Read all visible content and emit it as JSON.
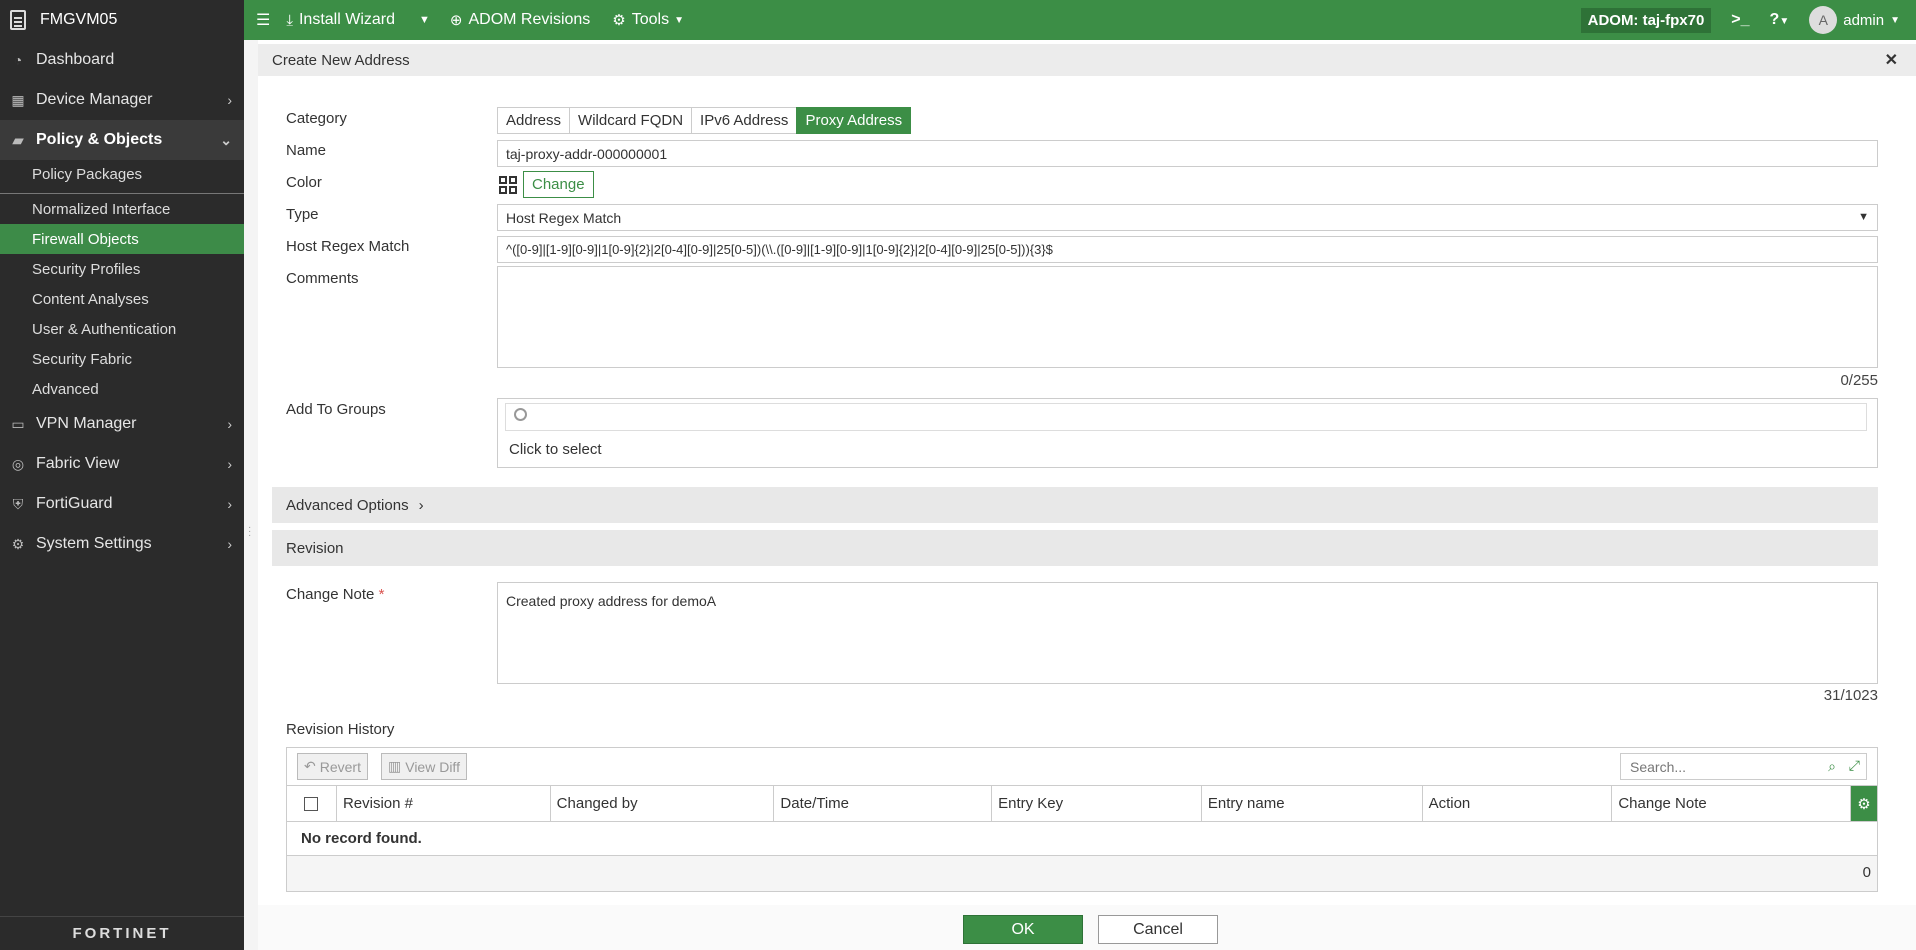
{
  "sidebar": {
    "device_name": "FMGVM05",
    "items": [
      {
        "label": "Dashboard",
        "icon": "dashboard-icon"
      },
      {
        "label": "Device Manager",
        "icon": "device-manager-icon"
      },
      {
        "label": "Policy & Objects",
        "icon": "policy-icon"
      },
      {
        "label": "VPN Manager",
        "icon": "vpn-icon"
      },
      {
        "label": "Fabric View",
        "icon": "fabric-icon"
      },
      {
        "label": "FortiGuard",
        "icon": "fortiguard-icon"
      },
      {
        "label": "System Settings",
        "icon": "settings-icon"
      }
    ],
    "subitems": [
      "Policy Packages",
      "Normalized Interface",
      "Firewall Objects",
      "Security Profiles",
      "Content Analyses",
      "User & Authentication",
      "Security Fabric",
      "Advanced"
    ],
    "active_subitem": "Firewall Objects",
    "footer": "FORTINET"
  },
  "topbar": {
    "install_wizard": "Install Wizard",
    "adom_revisions": "ADOM Revisions",
    "tools": "Tools",
    "adom": "ADOM: taj-fpx70",
    "user": "admin",
    "avatar_letter": "A"
  },
  "dialog": {
    "title": "Create New Address",
    "labels": {
      "category": "Category",
      "name": "Name",
      "color": "Color",
      "type": "Type",
      "host_regex": "Host Regex Match",
      "comments": "Comments",
      "add_to_groups": "Add To Groups",
      "change_note": "Change Note",
      "revision_history": "Revision History"
    },
    "categories": [
      "Address",
      "Wildcard FQDN",
      "IPv6 Address",
      "Proxy Address"
    ],
    "selected_category": "Proxy Address",
    "name_value": "taj-proxy-addr-000000001",
    "color_button": "Change",
    "type_value": "Host Regex Match",
    "host_regex_value": "^([0-9]|[1-9][0-9]|1[0-9]{2}|2[0-4][0-9]|25[0-5])(\\\\.([0-9]|[1-9][0-9]|1[0-9]{2}|2[0-4][0-9]|25[0-5])){3}$",
    "comments_counter": "0/255",
    "groups_placeholder": "Click to select",
    "advanced_options": "Advanced Options",
    "revision_section": "Revision",
    "change_note_value": "Created proxy address for demoA",
    "change_note_counter": "31/1023",
    "revert": "Revert",
    "view_diff": "View Diff",
    "search_placeholder": "Search...",
    "columns": [
      "Revision #",
      "Changed by",
      "Date/Time",
      "Entry Key",
      "Entry name",
      "Action",
      "Change Note"
    ],
    "no_record": "No record found.",
    "record_count": "0",
    "ok": "OK",
    "cancel": "Cancel"
  },
  "colors": {
    "accent": "#3c8e46",
    "sidebar_bg": "#2b2b2b"
  }
}
